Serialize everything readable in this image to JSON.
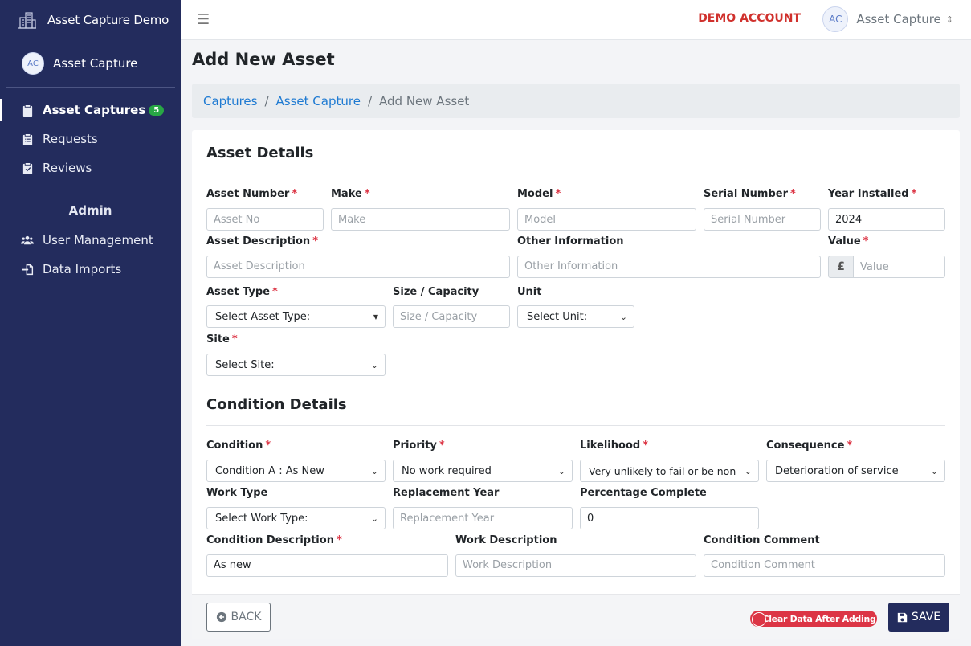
{
  "app": {
    "brand": "Asset Capture Demo",
    "user_initials": "AC",
    "user_name": "Asset Capture"
  },
  "sidebar": {
    "items": [
      {
        "label": "Asset Captures",
        "badge": "5",
        "icon": "clipboard-icon"
      },
      {
        "label": "Requests",
        "icon": "clipboard-list-icon"
      },
      {
        "label": "Reviews",
        "icon": "clipboard-check-icon"
      }
    ],
    "admin_heading": "Admin",
    "admin_items": [
      {
        "label": "User Management",
        "icon": "users-icon"
      },
      {
        "label": "Data Imports",
        "icon": "file-import-icon"
      }
    ]
  },
  "topbar": {
    "demo_label": "DEMO ACCOUNT",
    "user_initials": "AC",
    "user_name": "Asset Capture"
  },
  "page": {
    "title": "Add New Asset",
    "breadcrumb": [
      "Captures",
      "Asset Capture",
      "Add New Asset"
    ]
  },
  "asset_details": {
    "heading": "Asset Details",
    "asset_number": {
      "label": "Asset Number",
      "placeholder": "Asset No",
      "value": ""
    },
    "make": {
      "label": "Make",
      "placeholder": "Make",
      "value": ""
    },
    "model": {
      "label": "Model",
      "placeholder": "Model",
      "value": ""
    },
    "serial_number": {
      "label": "Serial Number",
      "placeholder": "Serial Number",
      "value": ""
    },
    "year_installed": {
      "label": "Year Installed",
      "value": "2024"
    },
    "asset_description": {
      "label": "Asset Description",
      "placeholder": "Asset Description"
    },
    "other_information": {
      "label": "Other Information",
      "placeholder": "Other Information"
    },
    "value": {
      "label": "Value",
      "currency": "£",
      "placeholder": "Value"
    },
    "asset_type": {
      "label": "Asset Type",
      "selected": "Select Asset Type:"
    },
    "size_capacity": {
      "label": "Size / Capacity",
      "placeholder": "Size / Capacity"
    },
    "unit": {
      "label": "Unit",
      "selected": "Select Unit:"
    },
    "site": {
      "label": "Site",
      "selected": "Select Site:"
    }
  },
  "condition_details": {
    "heading": "Condition Details",
    "condition": {
      "label": "Condition",
      "selected": "Condition A : As New"
    },
    "priority": {
      "label": "Priority",
      "selected": "No work required"
    },
    "likelihood": {
      "label": "Likelihood",
      "selected": "Very unlikely to fail or be non-"
    },
    "consequence": {
      "label": "Consequence",
      "selected": "Deterioration of service"
    },
    "work_type": {
      "label": "Work Type",
      "selected": "Select Work Type:"
    },
    "replacement_year": {
      "label": "Replacement Year",
      "placeholder": "Replacement Year"
    },
    "percentage_complete": {
      "label": "Percentage Complete",
      "value": "0"
    },
    "condition_description": {
      "label": "Condition Description",
      "value": "As new"
    },
    "work_description": {
      "label": "Work Description",
      "placeholder": "Work Description"
    },
    "condition_comment": {
      "label": "Condition Comment",
      "placeholder": "Condition Comment"
    }
  },
  "footer": {
    "back_label": "BACK",
    "clear_toggle_label": "Clear Data After Adding",
    "save_label": "SAVE"
  },
  "required_marker": "*"
}
